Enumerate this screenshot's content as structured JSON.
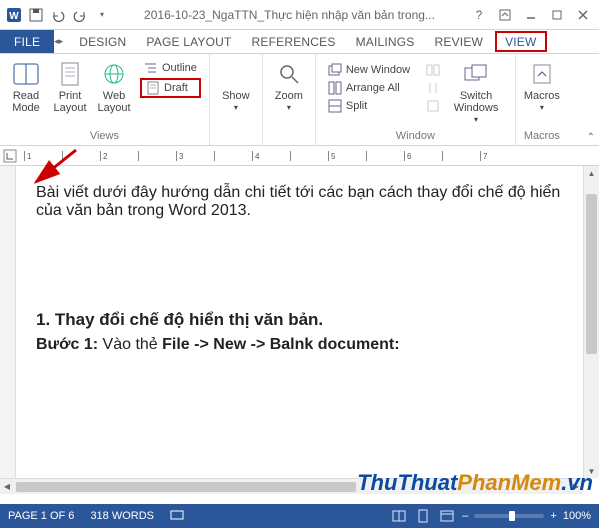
{
  "titlebar": {
    "title": "2016-10-23_NgaTTN_Thực hiện nhập văn bản trong..."
  },
  "qat": {
    "items": [
      "word-icon",
      "save-icon",
      "undo-icon",
      "redo-icon",
      "customize-dropdown"
    ]
  },
  "tabs": {
    "file": "FILE",
    "items": [
      "DESIGN",
      "PAGE LAYOUT",
      "REFERENCES",
      "MAILINGS",
      "REVIEW",
      "VIEW"
    ],
    "active": "VIEW",
    "highlighted": "VIEW"
  },
  "ribbon": {
    "views": {
      "label": "Views",
      "read_mode": "Read Mode",
      "print_layout": "Print Layout",
      "web_layout": "Web Layout",
      "outline": "Outline",
      "draft": "Draft"
    },
    "show_group": {
      "show": "Show"
    },
    "zoom_group": {
      "zoom": "Zoom"
    },
    "window_group": {
      "label": "Window",
      "new_window": "New Window",
      "arrange_all": "Arrange All",
      "split": "Split",
      "switch_windows": "Switch Windows"
    },
    "macros_group": {
      "label": "Macros",
      "macros": "Macros"
    }
  },
  "document": {
    "para1": "Bài viết dưới đây hướng dẫn chi tiết tới các bạn cách thay đổi chế độ hiển của văn bản trong Word 2013.",
    "heading1": "1. Thay đổi chế độ hiển thị văn bản.",
    "step_label": "Bước 1:",
    "step_text": " Vào thẻ ",
    "step_path": "File -> New -> Balnk document:"
  },
  "status": {
    "page": "PAGE 1 OF 6",
    "words": "318 WORDS",
    "lang_icon": "vietnamese-icon",
    "zoom": "100%"
  },
  "watermark": {
    "a": "ThuThuat",
    "b": "PhanMem",
    "c": ".vn"
  },
  "ruler_marks": [
    "1",
    "",
    "2",
    "",
    "3",
    "",
    "4",
    "",
    "5",
    "",
    "6",
    "",
    "7"
  ]
}
